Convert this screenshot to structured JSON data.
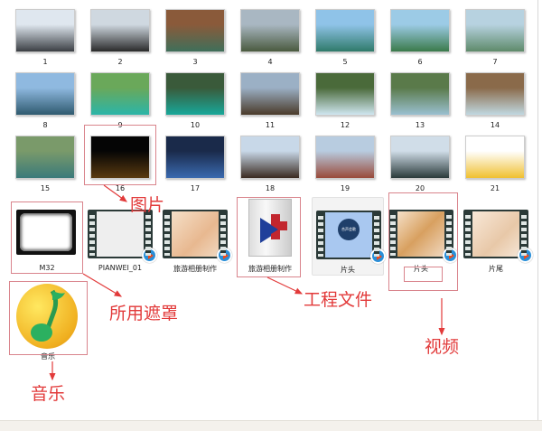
{
  "images": [
    {
      "label": "1",
      "colors": [
        "#dfe7ef",
        "#3b3f44"
      ]
    },
    {
      "label": "2",
      "colors": [
        "#cfd8e0",
        "#2a2a2a"
      ]
    },
    {
      "label": "3",
      "colors": [
        "#8a5a3a",
        "#3f6f5a"
      ]
    },
    {
      "label": "4",
      "colors": [
        "#a9b7c2",
        "#4a5a3f"
      ]
    },
    {
      "label": "5",
      "colors": [
        "#8fc3e8",
        "#2f7a6a"
      ]
    },
    {
      "label": "6",
      "colors": [
        "#9ccbe6",
        "#3a7a4a"
      ]
    },
    {
      "label": "7",
      "colors": [
        "#b7d2e0",
        "#5e8a6a"
      ]
    },
    {
      "label": "8",
      "colors": [
        "#8fb9e0",
        "#2f5a6f"
      ]
    },
    {
      "label": "9",
      "colors": [
        "#6aa85a",
        "#2bb5a8"
      ]
    },
    {
      "label": "10",
      "colors": [
        "#3a5a3a",
        "#18a89a"
      ]
    },
    {
      "label": "11",
      "colors": [
        "#9bb0c5",
        "#4a3a2a"
      ]
    },
    {
      "label": "12",
      "colors": [
        "#4a6a3a",
        "#cfe6f0"
      ]
    },
    {
      "label": "13",
      "colors": [
        "#5a7a4a",
        "#9ac0d0"
      ]
    },
    {
      "label": "14",
      "colors": [
        "#8a6a4a",
        "#c0d8e0"
      ]
    },
    {
      "label": "15",
      "colors": [
        "#7a9a6a",
        "#3a7a7a"
      ]
    },
    {
      "label": "16",
      "colors": [
        "#050505",
        "#5a3a10"
      ]
    },
    {
      "label": "17",
      "colors": [
        "#1a2a4a",
        "#3a6ab0"
      ]
    },
    {
      "label": "18",
      "colors": [
        "#c8d8e8",
        "#3a2a20"
      ]
    },
    {
      "label": "19",
      "colors": [
        "#b8cce0",
        "#9a4a3a"
      ]
    },
    {
      "label": "20",
      "colors": [
        "#d0dde8",
        "#2a3a3a"
      ]
    },
    {
      "label": "21",
      "colors": [
        "#ffffff",
        "#f0c030"
      ]
    }
  ],
  "files": {
    "mask": "M32",
    "pianwei": "PIANWEI_01",
    "video1": "旅游相册制作",
    "project": "旅游相册制作",
    "intro1": "片头",
    "intro2": "片头",
    "outro": "片尾",
    "music": "音乐",
    "intro1_badge": "合声会歌"
  },
  "annotations": {
    "pictures": "图片",
    "masks": "所用遮罩",
    "project": "工程文件",
    "video": "视频",
    "music": "音乐"
  },
  "colors": {
    "annotation": "#e23a3a",
    "box": "#d9848c"
  }
}
